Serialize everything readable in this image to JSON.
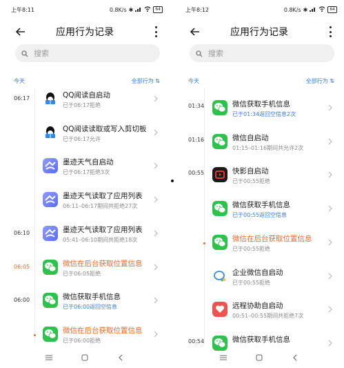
{
  "left": {
    "status": {
      "time": "上午8:11",
      "speed": "0.8K/s",
      "battery": "64"
    },
    "header": {
      "title": "应用行为记录"
    },
    "search": {
      "placeholder": "搜索"
    },
    "section": {
      "today": "今天",
      "filter": "全部行为"
    },
    "entries": [
      {
        "time": "06:17",
        "warn_time": false,
        "dot": false,
        "icon": "qq-read-icon",
        "title": "QQ阅读自启动",
        "sub": "已于06:17拒绝",
        "warn": false,
        "sub_blue": false
      },
      {
        "time": "",
        "warn_time": false,
        "dot": false,
        "icon": "qq-read-icon",
        "title": "QQ阅读读取或写入剪切板",
        "sub": "已于06:17允许",
        "warn": false,
        "sub_blue": false
      },
      {
        "time": "",
        "warn_time": false,
        "dot": false,
        "icon": "weather-icon",
        "title": "墨迹天气自启动",
        "sub": "已于06:17拒绝3次",
        "warn": false,
        "sub_blue": false
      },
      {
        "time": "",
        "warn_time": false,
        "dot": false,
        "icon": "weather-icon",
        "title": "墨迹天气读取了应用列表",
        "sub": "06:11–06:17期间共拒绝27次",
        "warn": false,
        "sub_blue": false
      },
      {
        "time": "06:10",
        "warn_time": false,
        "dot": false,
        "icon": "weather-icon",
        "title": "墨迹天气读取了应用列表",
        "sub": "05:41–06:10期间共拒绝18次",
        "warn": false,
        "sub_blue": false
      },
      {
        "time": "06:05",
        "warn_time": true,
        "dot": false,
        "icon": "wechat-icon",
        "title": "微信在后台获取位置信息",
        "sub": "已于06:05拒绝",
        "warn": true,
        "sub_blue": false
      },
      {
        "time": "06:00",
        "warn_time": false,
        "dot": false,
        "icon": "wechat-icon",
        "title": "微信获取手机信息",
        "sub": "已于06:00返回空信息",
        "warn": false,
        "sub_blue": true
      },
      {
        "time": "",
        "warn_time": false,
        "dot": true,
        "icon": "wechat-icon",
        "title": "微信在后台获取位置信息",
        "sub": "已于06:00拒绝",
        "warn": true,
        "sub_blue": false
      }
    ]
  },
  "right": {
    "status": {
      "time": "上午8:12",
      "speed": "0.8K/s",
      "battery": "64"
    },
    "header": {
      "title": "应用行为记录"
    },
    "search": {
      "placeholder": "搜索"
    },
    "section": {
      "today": "今天",
      "filter": "全部行为"
    },
    "entries": [
      {
        "time": "01:34",
        "warn_time": false,
        "dot": false,
        "icon": "wechat-icon",
        "title": "微信获取手机信息",
        "sub": "已于01:34返回空信息2次",
        "warn": false,
        "sub_blue": true
      },
      {
        "time": "01:16",
        "warn_time": false,
        "dot": false,
        "icon": "wechat-icon",
        "title": "微信自启动",
        "sub": "01:15–01:16期间共允许2次",
        "warn": false,
        "sub_blue": false
      },
      {
        "time": "00:55",
        "warn_time": false,
        "dot": false,
        "icon": "kuaiying-icon",
        "title": "快影自启动",
        "sub": "已于00:55拒绝",
        "warn": false,
        "sub_blue": false
      },
      {
        "time": "",
        "warn_time": false,
        "dot": false,
        "icon": "wechat-icon",
        "title": "微信获取手机信息",
        "sub": "已于00:55返回空信息",
        "warn": false,
        "sub_blue": true
      },
      {
        "time": "",
        "warn_time": false,
        "dot": true,
        "icon": "wechat-icon",
        "title": "微信在后台获取位置信息",
        "sub": "已于00:55拒绝",
        "warn": true,
        "sub_blue": false
      },
      {
        "time": "",
        "warn_time": false,
        "dot": false,
        "icon": "wework-icon",
        "title": "企业微信自启动",
        "sub": "已于00:55拒绝",
        "warn": false,
        "sub_blue": false
      },
      {
        "time": "",
        "warn_time": false,
        "dot": false,
        "icon": "remote-assist-icon",
        "title": "远程协助自启动",
        "sub": "00:51–00:55期间共拒绝7次",
        "warn": false,
        "sub_blue": false
      },
      {
        "time": "00:54",
        "warn_time": false,
        "dot": false,
        "icon": "wechat-icon",
        "title": "微信获取手机信息",
        "sub": "",
        "warn": false,
        "sub_blue": false
      }
    ]
  },
  "colors": {
    "accent": "#3a7bd5",
    "warning": "#e86a2a",
    "wechat": "#2dc24b"
  }
}
